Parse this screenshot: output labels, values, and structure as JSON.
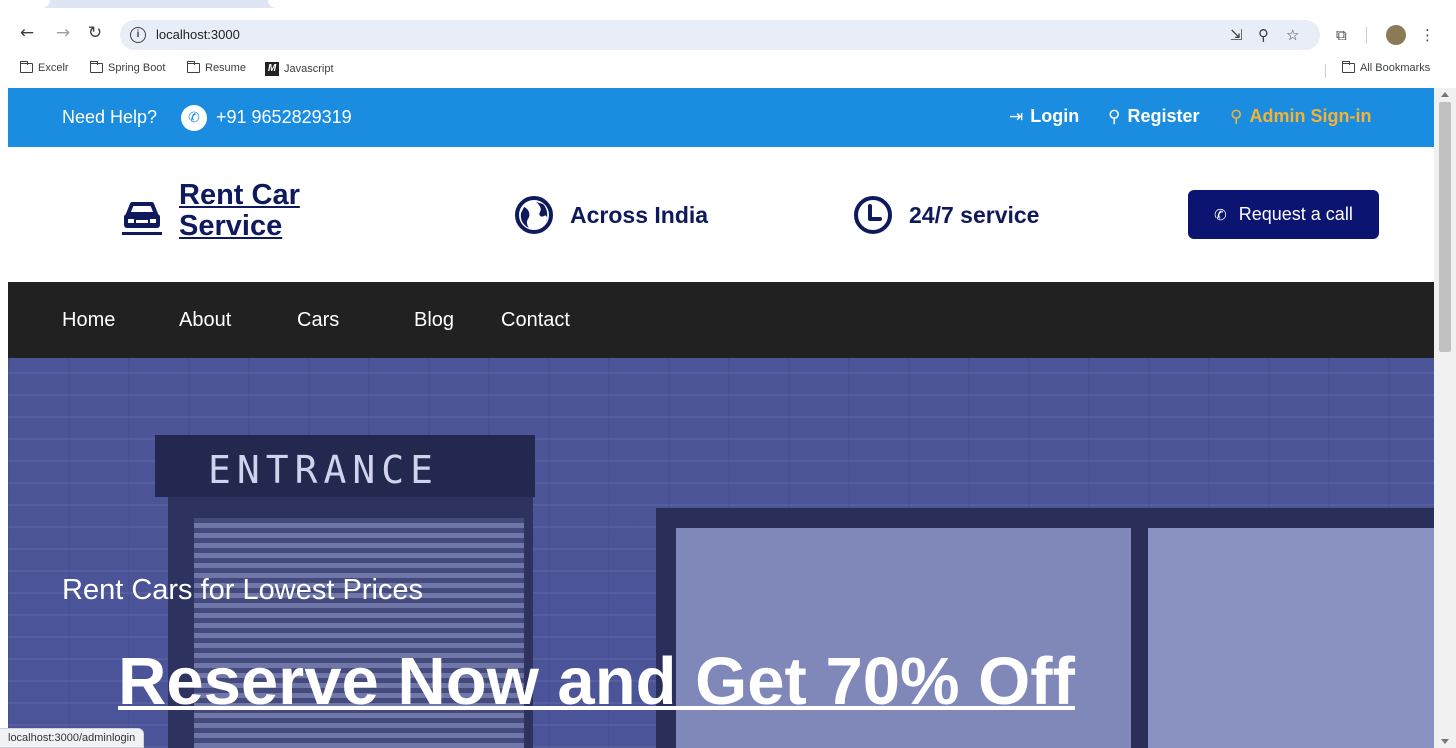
{
  "browser": {
    "url": "localhost:3000",
    "bookmarks": [
      {
        "label": "Excelr",
        "icon": "folder-icon"
      },
      {
        "label": "Spring Boot",
        "icon": "folder-icon"
      },
      {
        "label": "Resume",
        "icon": "folder-icon"
      },
      {
        "label": "Javascript",
        "icon": "m-logo"
      }
    ],
    "all_bookmarks": "All Bookmarks",
    "status_url": "localhost:3000/adminlogin"
  },
  "topbar": {
    "help_text": "Need Help?",
    "phone": "+91 9652829319",
    "login": "Login",
    "register": "Register",
    "admin_signin": "Admin Sign-in",
    "admin_color": "#f5b335",
    "bg_color": "#1a8de0"
  },
  "brand": {
    "line1": "Rent Car",
    "line2": "Service",
    "feature1": "Across India",
    "feature2": "24/7 service",
    "request_call": "Request a call",
    "brand_color": "#0e1a5c",
    "button_color": "#0b1470"
  },
  "menu": {
    "items": [
      "Home",
      "About",
      "Cars",
      "Blog",
      "Contact"
    ]
  },
  "hero": {
    "sign": "ENTRANCE",
    "subtitle": "Rent Cars for Lowest Prices",
    "title": "Reserve Now and Get 70% Off"
  }
}
